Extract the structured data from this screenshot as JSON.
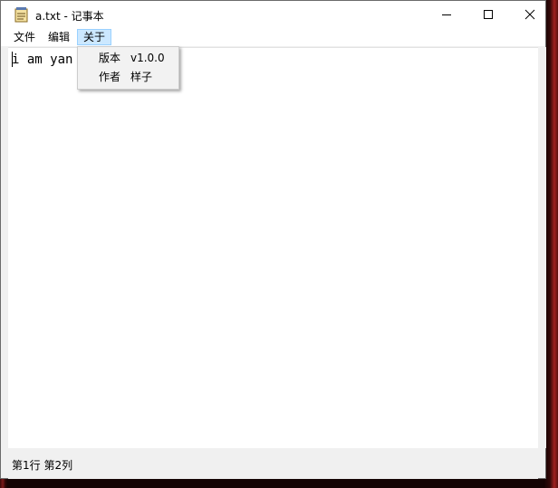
{
  "window": {
    "title": "a.txt - 记事本"
  },
  "menubar": {
    "items": [
      {
        "label": "文件"
      },
      {
        "label": "编辑"
      },
      {
        "label": "关于"
      }
    ]
  },
  "about_menu": {
    "items": [
      {
        "label": "版本",
        "value": "v1.0.0"
      },
      {
        "label": "作者",
        "value": "样子"
      }
    ]
  },
  "editor": {
    "content": "i am yan"
  },
  "statusbar": {
    "position": "第1行 第2列"
  },
  "icons": {
    "app": "notepad-icon",
    "minimize": "minimize-icon",
    "maximize": "maximize-icon",
    "close": "close-icon"
  }
}
